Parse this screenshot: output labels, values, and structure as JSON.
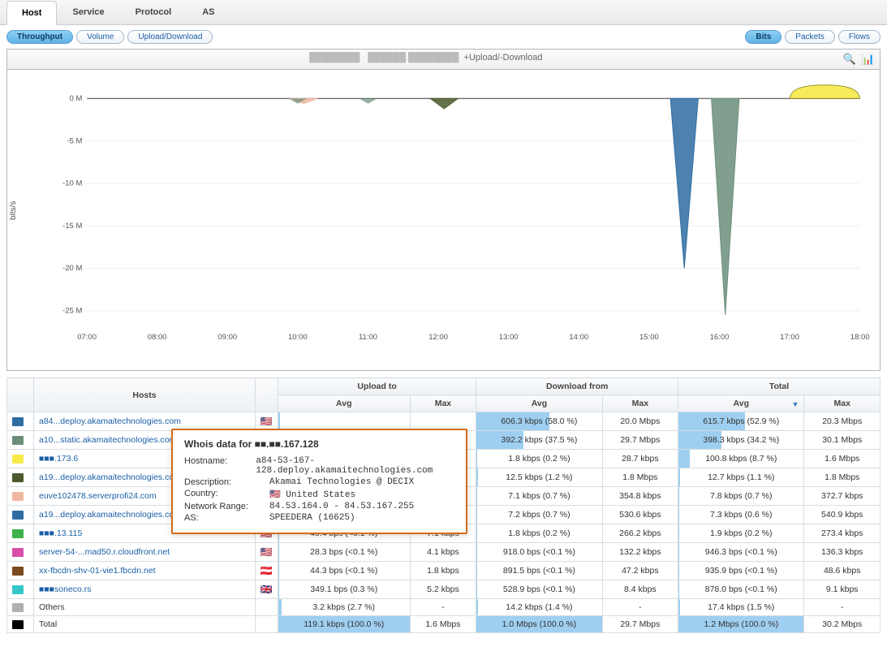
{
  "tabs": {
    "items": [
      "Host",
      "Service",
      "Protocol",
      "AS"
    ],
    "active": 0
  },
  "pills_left": {
    "items": [
      "Throughput",
      "Volume",
      "Upload/Download"
    ],
    "active": 0
  },
  "pills_right": {
    "items": [
      "Bits",
      "Packets",
      "Flows"
    ],
    "active": 0
  },
  "chart": {
    "title_suffix": "+Upload/-Download",
    "ylabel": "bits/s",
    "icons": {
      "zoom": "🔍",
      "stack": "📊"
    }
  },
  "chart_data": {
    "type": "area",
    "ylabel": "bits/s",
    "ylim": [
      -27000000,
      2000000
    ],
    "x": [
      "07:00",
      "08:00",
      "09:00",
      "10:00",
      "11:00",
      "12:00",
      "13:00",
      "14:00",
      "15:00",
      "16:00",
      "17:00",
      "18:00"
    ],
    "y_ticks": [
      0,
      -5000000,
      -10000000,
      -15000000,
      -20000000,
      -25000000
    ],
    "y_tick_labels": [
      "0 M",
      "-5 M",
      "-10 M",
      "-15 M",
      "-20 M",
      "-25 M"
    ],
    "annotations": [
      "+Upload/-Download"
    ],
    "series": [
      {
        "name": "a84...deploy.akamaitechnologies.com",
        "color": "#2e6ca2",
        "role": "download",
        "peak_time": "15:30",
        "peak_value": -20000000
      },
      {
        "name": "a10...static.akamaitechnologies.com",
        "color": "#6b8e7a",
        "role": "download",
        "peak_time": "16:05",
        "peak_value": -25500000
      },
      {
        "name": "■■■.173.6",
        "color": "#f7e948",
        "role": "upload",
        "peak_time": "17:30",
        "peak_value": 1600000
      },
      {
        "name": "a19...deploy.akamaitechnologies.com",
        "color": "#4a5a2e",
        "role": "download",
        "peak_time": "12:05",
        "peak_value": -1200000
      },
      {
        "name": "euve102478.serverprofi24.com",
        "color": "#f0b7a0",
        "role": "download",
        "peak_time": "10:05",
        "peak_value": -600000
      }
    ]
  },
  "table": {
    "group_headers": [
      "Upload to",
      "Download from",
      "Total"
    ],
    "headers": {
      "hosts": "Hosts",
      "avg": "Avg",
      "max": "Max",
      "sorted": "avg_total"
    },
    "rows": [
      {
        "color": "#2e6ca2",
        "host": "a84...deploy.akamaitechnologies.com",
        "flag": "🇺🇸",
        "u_avg": "",
        "u_avg_pct": 1,
        "u_max": "",
        "d_avg": "606.3 kbps (58.0 %)",
        "d_avg_pct": 58,
        "d_max": "20.0 Mbps",
        "t_avg": "615.7 kbps (52.9 %)",
        "t_avg_pct": 52.9,
        "t_max": "20.3 Mbps"
      },
      {
        "color": "#6b8e7a",
        "host": "a10...static.akamaitechnologies.com",
        "flag": "🇺🇸",
        "u_avg": "",
        "u_avg_pct": 0,
        "u_max": "",
        "d_avg": "392.2 kbps (37.5 %)",
        "d_avg_pct": 37.5,
        "d_max": "29.7 Mbps",
        "t_avg": "398.3 kbps (34.2 %)",
        "t_avg_pct": 34.2,
        "t_max": "30.1 Mbps"
      },
      {
        "color": "#f7e948",
        "host": "■■■.173.6",
        "flag": "🇩🇪",
        "u_avg": "",
        "u_avg_pct": 0,
        "u_max": "",
        "d_avg": "1.8 kbps (0.2 %)",
        "d_avg_pct": 0.2,
        "d_max": "28.7 kbps",
        "t_avg": "100.8 kbps (8.7 %)",
        "t_avg_pct": 8.7,
        "t_max": "1.6 Mbps"
      },
      {
        "color": "#4a5a2e",
        "host": "a19...deploy.akamaitechnologies.com",
        "flag": "🇺🇸",
        "u_avg": "",
        "u_avg_pct": 0,
        "u_max": "",
        "d_avg": "12.5 kbps (1.2 %)",
        "d_avg_pct": 1.2,
        "d_max": "1.8 Mbps",
        "t_avg": "12.7 kbps (1.1 %)",
        "t_avg_pct": 1.1,
        "t_max": "1.8 Mbps"
      },
      {
        "color": "#f0b7a0",
        "host": "euve102478.serverprofi24.com",
        "flag": "🇩🇪",
        "u_avg": "",
        "u_avg_pct": 0,
        "u_max": "",
        "d_avg": "7.1 kbps (0.7 %)",
        "d_avg_pct": 0.7,
        "d_max": "354.8 kbps",
        "t_avg": "7.8 kbps (0.7 %)",
        "t_avg_pct": 0.7,
        "t_max": "372.7 kbps"
      },
      {
        "color": "#2e6ca2",
        "host": "a19...deploy.akamaitechnologies.com",
        "flag": "🇺🇸",
        "u_avg": "",
        "u_avg_pct": 0,
        "u_max": "",
        "d_avg": "7.2 kbps (0.7 %)",
        "d_avg_pct": 0.7,
        "d_max": "530.6 kbps",
        "t_avg": "7.3 kbps (0.6 %)",
        "t_avg_pct": 0.6,
        "t_max": "540.9 kbps"
      },
      {
        "color": "#3cb44b",
        "host": "■■■.13.115",
        "flag": "🇺🇸",
        "u_avg": "49.4 bps (<0.1 %)",
        "u_avg_pct": 0.1,
        "u_max": "7.1 kbps",
        "d_avg": "1.8 kbps (0.2 %)",
        "d_avg_pct": 0.2,
        "d_max": "266.2 kbps",
        "t_avg": "1.9 kbps (0.2 %)",
        "t_avg_pct": 0.2,
        "t_max": "273.4 kbps"
      },
      {
        "color": "#d94ea8",
        "host": "server-54-...mad50.r.cloudfront.net",
        "flag": "🇺🇸",
        "u_avg": "28.3 bps (<0.1 %)",
        "u_avg_pct": 0.1,
        "u_max": "4.1 kbps",
        "d_avg": "918.0 bps (<0.1 %)",
        "d_avg_pct": 0.1,
        "d_max": "132.2 kbps",
        "t_avg": "946.3 bps (<0.1 %)",
        "t_avg_pct": 0.1,
        "t_max": "136.3 kbps"
      },
      {
        "color": "#7a4a1e",
        "host": "xx-fbcdn-shv-01-vie1.fbcdn.net",
        "flag": "🇦🇹",
        "u_avg": "44.3 bps (<0.1 %)",
        "u_avg_pct": 0.1,
        "u_max": "1.8 kbps",
        "d_avg": "891.5 bps (<0.1 %)",
        "d_avg_pct": 0.1,
        "d_max": "47.2 kbps",
        "t_avg": "935.9 bps (<0.1 %)",
        "t_avg_pct": 0.1,
        "t_max": "48.6 kbps"
      },
      {
        "color": "#35c6c9",
        "host": "■■■soneco.rs",
        "flag": "🇬🇧",
        "u_avg": "349.1 bps (0.3 %)",
        "u_avg_pct": 0.3,
        "u_max": "5.2 kbps",
        "d_avg": "528.9 bps (<0.1 %)",
        "d_avg_pct": 0.1,
        "d_max": "8.4 kbps",
        "t_avg": "878.0 bps (<0.1 %)",
        "t_avg_pct": 0.1,
        "t_max": "9.1 kbps"
      },
      {
        "color": "#b0b0b0",
        "host": "Others",
        "flag": "",
        "plain": true,
        "u_avg": "3.2 kbps (2.7 %)",
        "u_avg_pct": 2.7,
        "u_max": "-",
        "d_avg": "14.2 kbps (1.4 %)",
        "d_avg_pct": 1.4,
        "d_max": "-",
        "t_avg": "17.4 kbps (1.5 %)",
        "t_avg_pct": 1.5,
        "t_max": "-"
      },
      {
        "color": "#000000",
        "host": "Total",
        "flag": "",
        "plain": true,
        "u_avg": "119.1 kbps (100.0 %)",
        "u_avg_pct": 100,
        "u_max": "1.6 Mbps",
        "d_avg": "1.0 Mbps (100.0 %)",
        "d_avg_pct": 100,
        "d_max": "29.7 Mbps",
        "t_avg": "1.2 Mbps (100.0 %)",
        "t_avg_pct": 100,
        "t_max": "30.2 Mbps"
      }
    ]
  },
  "whois": {
    "title": "Whois data for ■■.■■.167.128",
    "fields": [
      {
        "k": "Hostname:",
        "v": "a84-53-167-128.deploy.akamaitechnologies.com"
      },
      {
        "k": "Description:",
        "v": "Akamai Technologies @ DECIX"
      },
      {
        "k": "Country:",
        "v": "🇺🇸 United States"
      },
      {
        "k": "Network Range:",
        "v": "84.53.164.0 - 84.53.167.255"
      },
      {
        "k": "AS:",
        "v": "SPEEDERA (16625)"
      }
    ]
  }
}
